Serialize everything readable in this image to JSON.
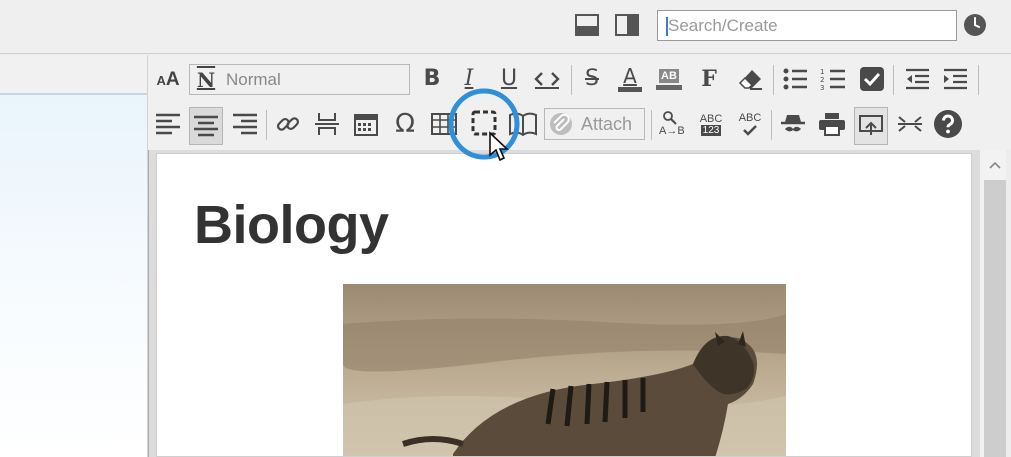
{
  "header": {
    "search": {
      "placeholder": "Search/Create",
      "value": ""
    },
    "icons": [
      "layout-bottom-pane-icon",
      "layout-right-pane-icon",
      "clock-icon"
    ]
  },
  "toolbar": {
    "font_size_label": "AA",
    "style_select": {
      "icon": "N",
      "value": "Normal"
    },
    "attach_label": "Attach",
    "ab_label": "AB",
    "abc_label": "ABC",
    "num_label": "123",
    "find_label_a": "A",
    "find_label_b": "B",
    "format_label": "F",
    "omega": "Ω"
  },
  "editor": {
    "title": "Biology",
    "image_alt": "thylacine photograph"
  },
  "colors": {
    "highlight": "#2f8fd8",
    "accent": "#3a7bd5"
  }
}
